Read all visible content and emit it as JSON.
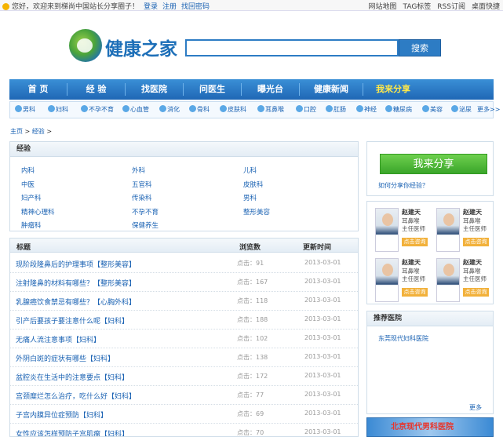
{
  "topbar": {
    "welcome": "您好，欢迎来到梯尚中国站长分享圈子！",
    "login": "登录",
    "register": "注册",
    "find_password": "找回密码",
    "site_map": "网站地图",
    "tag": "TAG标签",
    "rss": "RSS订阅",
    "desktop": "桌面快捷"
  },
  "header": {
    "logo_text": "健康之家",
    "search_button": "搜索",
    "search_value": ""
  },
  "nav": [
    "首 页",
    "经 验",
    "找医院",
    "问医生",
    "曝光台",
    "健康新闻",
    "我来分享"
  ],
  "departments": [
    "男科",
    "妇科",
    "不孕不育",
    "心血管",
    "消化",
    "骨科",
    "皮肤科",
    "耳鼻喉",
    "口腔",
    "肛肠",
    "神经",
    "糖尿病",
    "美容",
    "泌尿",
    "更多>>"
  ],
  "breadcrumb": {
    "home": "主页",
    "current": "经验",
    "sep": ">"
  },
  "experience": {
    "title": "经验",
    "categories": [
      [
        "内科",
        "外科",
        "儿科"
      ],
      [
        "中医",
        "五官科",
        "皮肤科"
      ],
      [
        "妇产科",
        "传染科",
        "男科"
      ],
      [
        "精神心理科",
        "不孕不育",
        "整形美容"
      ],
      [
        "肿瘤科",
        "保健养生",
        ""
      ]
    ]
  },
  "table": {
    "headers": [
      "标题",
      "浏览数",
      "更新时间"
    ],
    "rows": [
      {
        "title": "现阶段隆鼻后的护理事项【整形美容】",
        "views": "点击：91",
        "date": "2013-03-01"
      },
      {
        "title": "注射隆鼻的材料有哪些？【整形美容】",
        "views": "点击：167",
        "date": "2013-03-01"
      },
      {
        "title": "乳腺癌饮食禁忌有哪些？【心胸外科】",
        "views": "点击：118",
        "date": "2013-03-01"
      },
      {
        "title": "引产后要孩子要注意什么呢【妇科】",
        "views": "点击：188",
        "date": "2013-03-01"
      },
      {
        "title": "无痛人流注意事项【妇科】",
        "views": "点击：102",
        "date": "2013-03-01"
      },
      {
        "title": "外阴白斑的症状有哪些【妇科】",
        "views": "点击：138",
        "date": "2013-03-01"
      },
      {
        "title": "盆腔炎在生活中的注意要点【妇科】",
        "views": "点击：172",
        "date": "2013-03-01"
      },
      {
        "title": "宫颈糜烂怎么治疗，吃什么好【妇科】",
        "views": "点击：77",
        "date": "2013-03-01"
      },
      {
        "title": "子宫内膜异位症预防【妇科】",
        "views": "点击：69",
        "date": "2013-03-01"
      },
      {
        "title": "女性应该怎样预防子宫肌瘤【妇科】",
        "views": "点击：70",
        "date": "2013-03-01"
      }
    ]
  },
  "sidebar": {
    "share_button": "我来分享",
    "share_help": "如何分享你经验？",
    "doctors": [
      {
        "name": "赵建天",
        "dept": "耳鼻喉",
        "title": "主任医师",
        "ask": "点击咨询"
      },
      {
        "name": "赵建天",
        "dept": "耳鼻喉",
        "title": "主任医师",
        "ask": "点击咨询"
      },
      {
        "name": "赵建天",
        "dept": "耳鼻喉",
        "title": "主任医师",
        "ask": "点击咨询"
      },
      {
        "name": "赵建天",
        "dept": "耳鼻喉",
        "title": "主任医师",
        "ask": "点击咨询"
      }
    ],
    "hospitals_title": "推荐医院",
    "hospital": "东莞现代妇科医院",
    "more": "更多",
    "banner": "北京现代男科医院"
  }
}
